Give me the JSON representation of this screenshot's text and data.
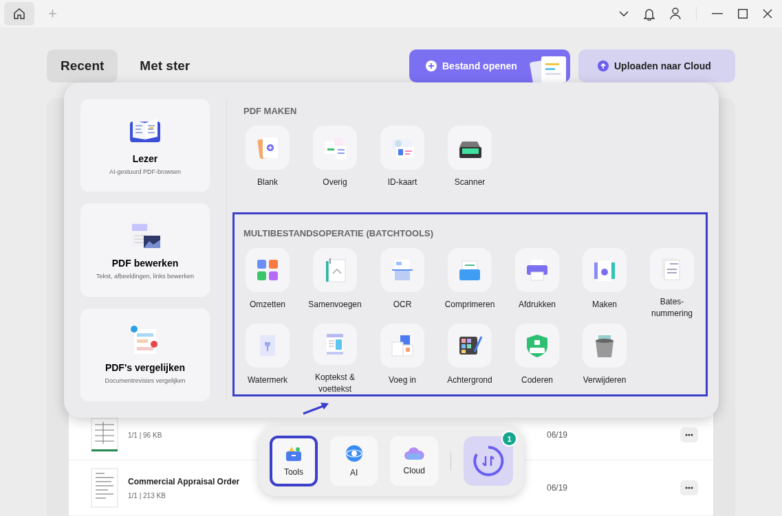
{
  "title_bar": {
    "new_tab": "+"
  },
  "tabs": [
    {
      "label": "Recent",
      "selected": true
    },
    {
      "label": "Met ster",
      "selected": false
    }
  ],
  "actions": [
    {
      "kind": "primary",
      "label": "Bestand openen"
    },
    {
      "kind": "secondary",
      "label": "Uploaden naar Cloud"
    }
  ],
  "files": [
    {
      "meta": "1/1 | 96 KB",
      "date": "06/19",
      "kind": "sheet"
    },
    {
      "name": "Commercial Appraisal Order",
      "meta": "1/1 | 213 KB",
      "date": "06/19",
      "kind": "doc"
    }
  ],
  "tools_panel": {
    "features": [
      {
        "title": "Lezer",
        "subtitle": "AI-gestuurd PDF-browsen"
      },
      {
        "title": "PDF bewerken",
        "subtitle": "Tekst, afbeeldingen, links bewerken"
      },
      {
        "title": "PDF's vergelijken",
        "subtitle": "Documentrevisies vergelijken"
      }
    ],
    "sections": [
      {
        "title": "PDF MAKEN",
        "highlighted": false,
        "tools": [
          "Blank",
          "Overig",
          "ID-kaart",
          "Scanner"
        ]
      },
      {
        "title": "MULTIBESTANDSOPERATIE (BATCHTOOLS)",
        "highlighted": true,
        "tools": [
          "Omzetten",
          "Samenvoegen",
          "OCR",
          "Comprimeren",
          "Afdrukken",
          "Maken",
          "Bates-nummering",
          "Watermerk",
          "Koptekst & voettekst",
          "Voeg in",
          "Achtergrond",
          "Coderen",
          "Verwijderen"
        ]
      }
    ]
  },
  "dock": {
    "items": [
      {
        "label": "Tools",
        "selected": true
      },
      {
        "label": "AI",
        "selected": false
      },
      {
        "label": "Cloud",
        "selected": false
      }
    ],
    "sync_badge": "1"
  }
}
